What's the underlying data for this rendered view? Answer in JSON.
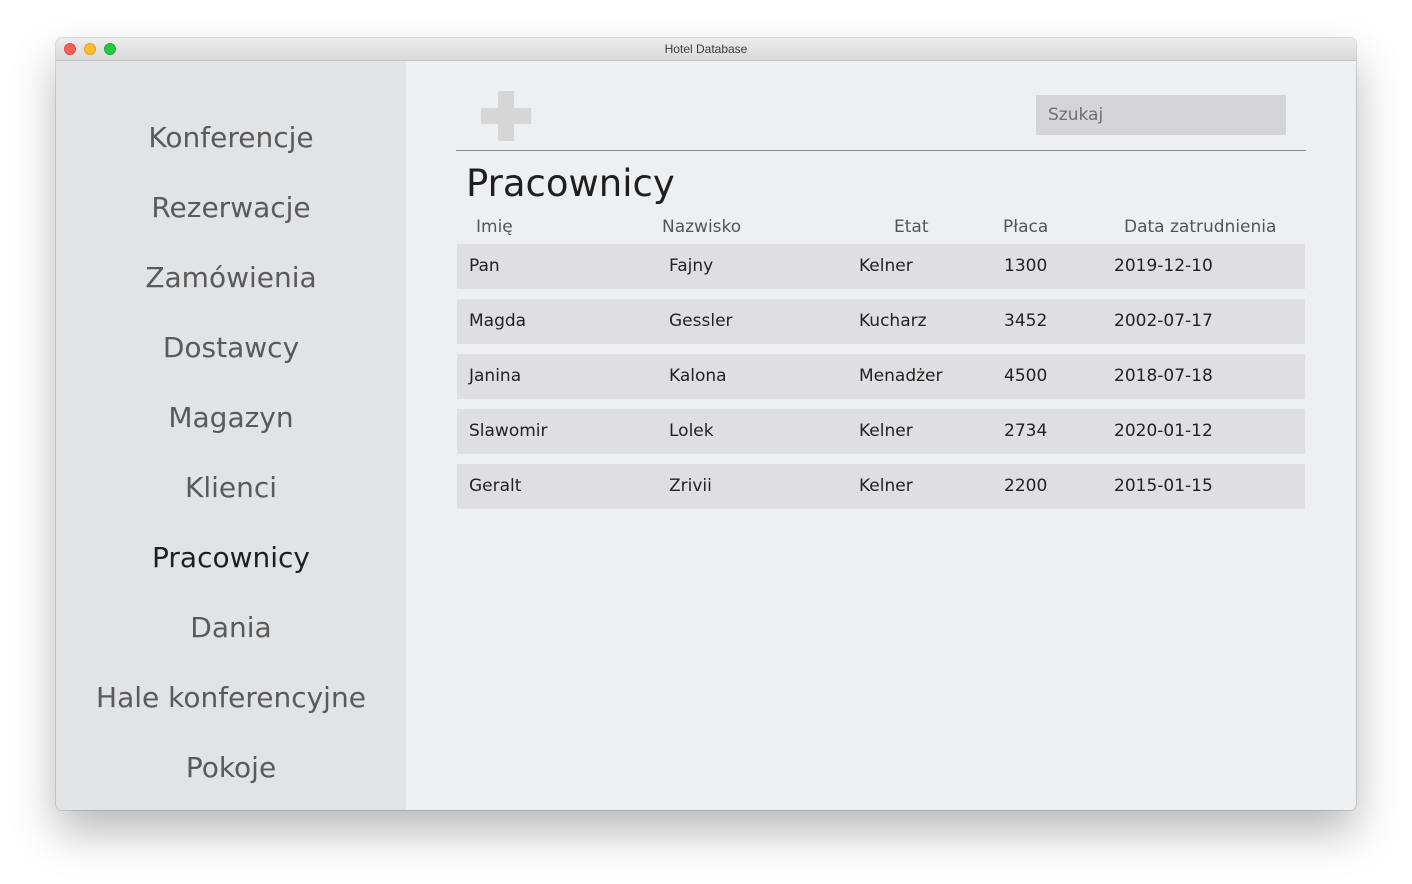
{
  "window": {
    "title": "Hotel Database"
  },
  "sidebar": {
    "items": [
      {
        "label": "Konferencje"
      },
      {
        "label": "Rezerwacje"
      },
      {
        "label": "Zamówienia"
      },
      {
        "label": "Dostawcy"
      },
      {
        "label": "Magazyn"
      },
      {
        "label": "Klienci"
      },
      {
        "label": "Pracownicy",
        "active": true
      },
      {
        "label": "Dania"
      },
      {
        "label": "Hale konferencyjne"
      },
      {
        "label": "Pokoje"
      }
    ]
  },
  "toolbar": {
    "add_icon": "plus-icon",
    "search_placeholder": "Szukaj"
  },
  "main": {
    "title": "Pracownicy",
    "columns": [
      "Imię",
      "Nazwisko",
      "Etat",
      "Płaca",
      "Data zatrudnienia"
    ],
    "rows": [
      [
        "Pan",
        "Fajny",
        "Kelner",
        "1300",
        "2019-12-10"
      ],
      [
        "Magda",
        "Gessler",
        "Kucharz",
        "3452",
        "2002-07-17"
      ],
      [
        "Janina",
        "Kalona",
        "Menadżer",
        "4500",
        "2018-07-18"
      ],
      [
        "Slawomir",
        "Lolek",
        "Kelner",
        "2734",
        "2020-01-12"
      ],
      [
        "Geralt",
        "Zrivii",
        "Kelner",
        "2200",
        "2015-01-15"
      ]
    ]
  },
  "colors": {
    "sidebar_bg": "#e2e3e5",
    "content_bg": "#eeeff1",
    "row_bg": "#dfdfe1",
    "search_bg": "#d5d5d7",
    "add_icon": "#d6d6d6"
  }
}
